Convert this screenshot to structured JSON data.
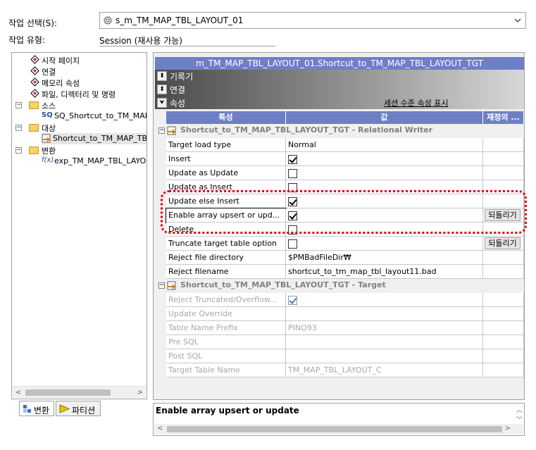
{
  "top": {
    "task_select_label": "작업 선택(S):",
    "task_select_value": "s_m_TM_MAP_TBL_LAYOUT_01",
    "task_type_label": "작업 유형:",
    "task_type_value": "Session (재사용 가능)"
  },
  "tree": {
    "items": [
      {
        "label": "시작 페이지"
      },
      {
        "label": "연결"
      },
      {
        "label": "메모리 속성"
      },
      {
        "label": "파일, 디렉터리 및 명령"
      },
      {
        "label": "소스"
      },
      {
        "label": "SQ_Shortcut_to_TM_MAP_"
      },
      {
        "label": "대상"
      },
      {
        "label": "Shortcut_to_TM_MAP_TBL_"
      },
      {
        "label": "변환"
      },
      {
        "label": "exp_TM_MAP_TBL_LAYOUT"
      }
    ]
  },
  "tabs": [
    {
      "label": "변환"
    },
    {
      "label": "파티션"
    }
  ],
  "panel": {
    "title": "m_TM_MAP_TBL_LAYOUT_01.Shortcut_to_TM_MAP_TBL_LAYOUT_TGT",
    "rows": [
      {
        "label": "기록기"
      },
      {
        "label": "연결"
      },
      {
        "label": "속성"
      }
    ],
    "session_link": "세션 수준 속성 표시"
  },
  "grid": {
    "headers": [
      "특성",
      "값",
      "재정의 ..."
    ],
    "groups": [
      {
        "title": "Shortcut_to_TM_MAP_TBL_LAYOUT_TGT - Relational Writer",
        "rows": [
          {
            "name": "Target load type",
            "value": "Normal",
            "checkbox": false,
            "checked": false,
            "revert": ""
          },
          {
            "name": "Insert",
            "value": "",
            "checkbox": true,
            "checked": true,
            "revert": ""
          },
          {
            "name": "Update as Update",
            "value": "",
            "checkbox": true,
            "checked": false,
            "revert": ""
          },
          {
            "name": "Update as Insert",
            "value": "",
            "checkbox": true,
            "checked": false,
            "revert": ""
          },
          {
            "name": "Update else Insert",
            "value": "",
            "checkbox": true,
            "checked": true,
            "revert": ""
          },
          {
            "name": "Enable array upsert or upd...",
            "value": "",
            "checkbox": true,
            "checked": true,
            "revert": "되돌리기"
          },
          {
            "name": "Delete",
            "value": "",
            "checkbox": true,
            "checked": false,
            "revert": ""
          },
          {
            "name": "Truncate target table option",
            "value": "",
            "checkbox": true,
            "checked": false,
            "revert": "되돌리기"
          },
          {
            "name": "Reject file directory",
            "value": "$PMBadFileDir₩",
            "checkbox": false,
            "checked": false,
            "revert": ""
          },
          {
            "name": "Reject filename",
            "value": "shortcut_to_tm_map_tbl_layout11.bad",
            "checkbox": false,
            "checked": false,
            "revert": ""
          }
        ]
      },
      {
        "title": "Shortcut_to_TM_MAP_TBL_LAYOUT_TGT - Target",
        "rows": [
          {
            "name": "Reject Truncated/Overflow...",
            "value": "",
            "checkbox": true,
            "checked": true,
            "revert": ""
          },
          {
            "name": "Update Override",
            "value": "",
            "checkbox": false,
            "checked": false,
            "revert": ""
          },
          {
            "name": "Table Name Prefix",
            "value": "PINO93",
            "checkbox": false,
            "checked": false,
            "revert": ""
          },
          {
            "name": "Pre SQL",
            "value": "",
            "checkbox": false,
            "checked": false,
            "revert": ""
          },
          {
            "name": "Post SQL",
            "value": "",
            "checkbox": false,
            "checked": false,
            "revert": ""
          },
          {
            "name": "Target Table Name",
            "value": "TM_MAP_TBL_LAYOUT_C",
            "checkbox": false,
            "checked": false,
            "revert": ""
          }
        ]
      }
    ]
  },
  "description": {
    "text": "Enable array upsert or update"
  },
  "colors": {
    "header_blue": "#6e7fc6",
    "highlight_red": "#e00000"
  }
}
